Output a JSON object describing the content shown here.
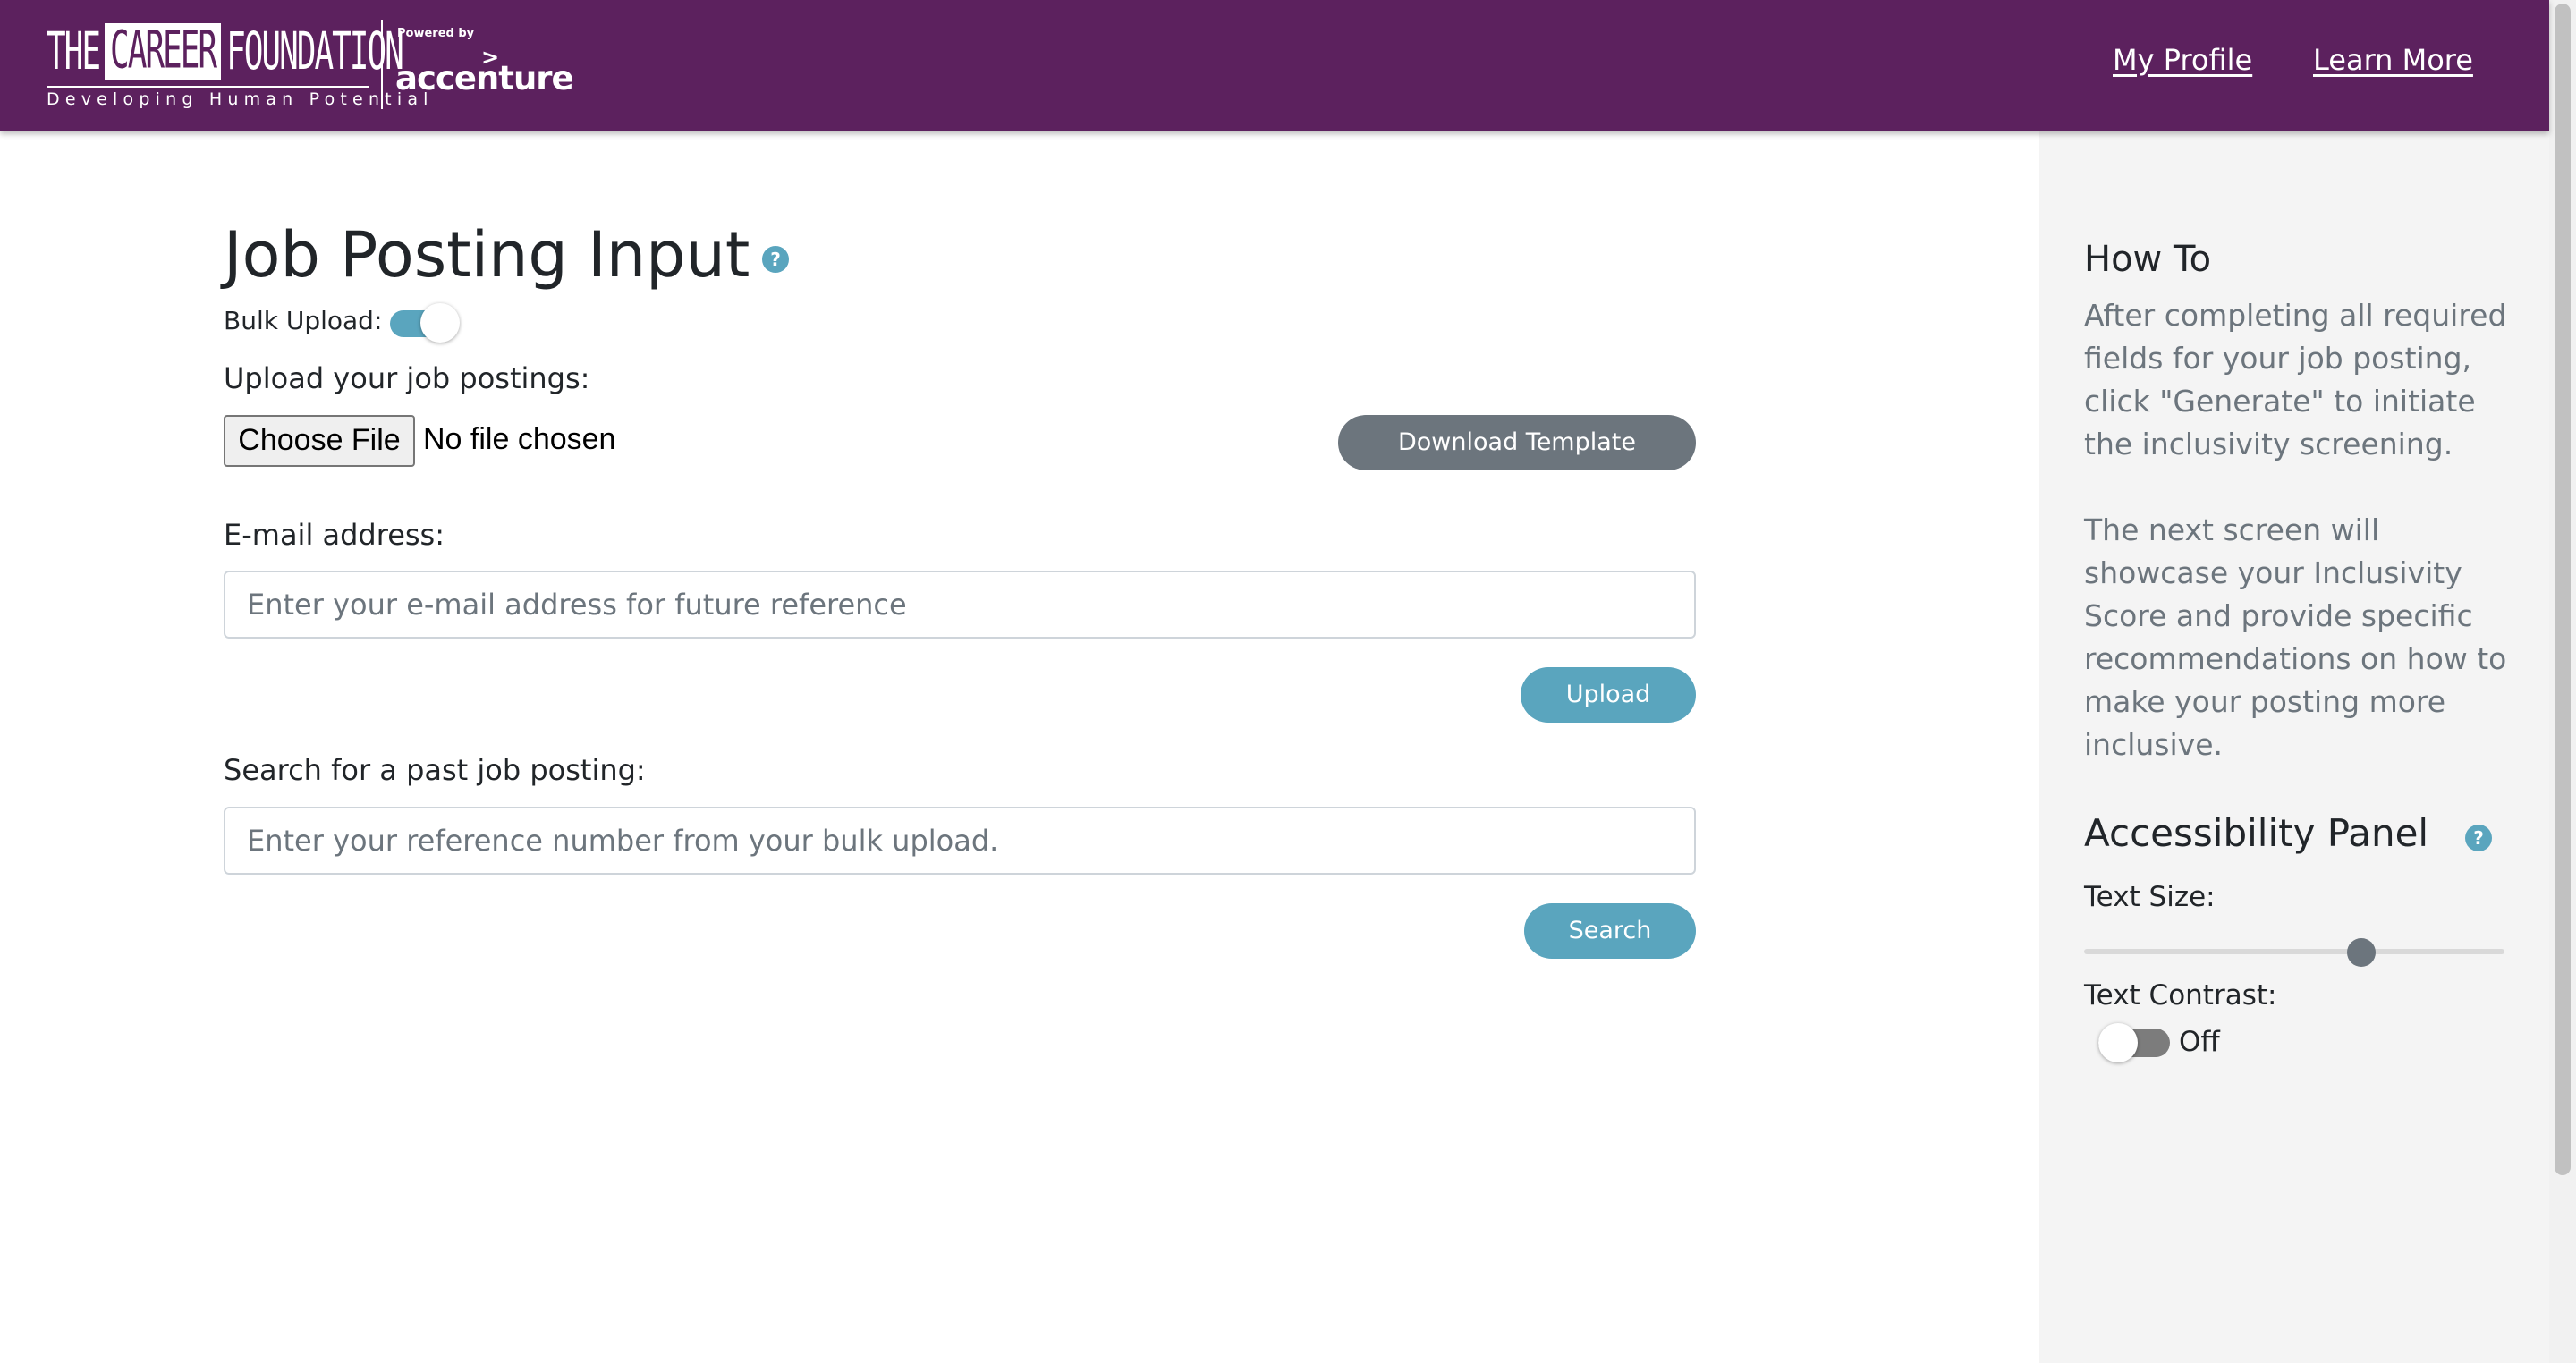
{
  "header": {
    "logo": {
      "the": "THE",
      "career": "CAREER",
      "foundation": "FOUNDATION",
      "tagline": "Developing Human Potential"
    },
    "powered_by": "Powered by",
    "partner_mark": ">",
    "partner": "accenture",
    "nav": {
      "profile": "My Profile",
      "learn_more": "Learn More"
    }
  },
  "main": {
    "title": "Job Posting Input",
    "help_icon": "?",
    "bulk_upload": {
      "label": "Bulk Upload:",
      "enabled": true
    },
    "upload": {
      "label": "Upload your job postings:",
      "choose_file": "Choose File",
      "file_status": "No file chosen",
      "download_template": "Download Template"
    },
    "email": {
      "label": "E-mail address:",
      "placeholder": "Enter your e-mail address for future reference",
      "value": ""
    },
    "upload_button": "Upload",
    "search": {
      "label": "Search for a past job posting:",
      "placeholder": "Enter your reference number from your bulk upload.",
      "value": "",
      "button": "Search"
    }
  },
  "sidebar": {
    "howto_title": "How To",
    "howto_p1": "After completing all required fields for your job posting, click \"Generate\" to initiate the inclusivity screening.",
    "howto_p2": "The next screen will showcase your Inclusivity Score and provide specific recommendations on how to make your posting more inclusive.",
    "accessibility": {
      "title": "Accessibility Panel",
      "help_icon": "?",
      "text_size_label": "Text Size:",
      "text_size_level": 0.65,
      "text_contrast_label": "Text Contrast:",
      "text_contrast_state": "Off"
    }
  },
  "colors": {
    "header_bg": "#5c215e",
    "accent": "#5aa5be",
    "secondary_button": "#6c757d",
    "sidebar_bg": "#f4f4f4"
  },
  "icons": [
    "question-circle-icon",
    "question-circle-icon"
  ]
}
